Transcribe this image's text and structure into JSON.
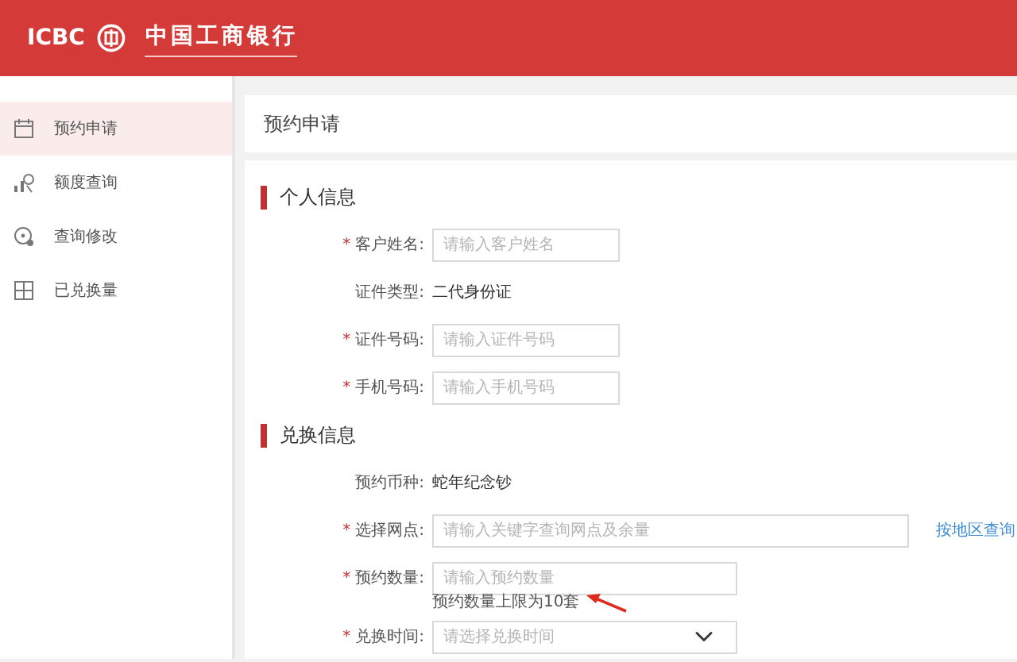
{
  "header": {
    "logo_text": "ICBC",
    "bank_name": "中国工商银行"
  },
  "sidebar": {
    "items": [
      {
        "label": "预约申请",
        "selected": true
      },
      {
        "label": "额度查询",
        "selected": false
      },
      {
        "label": "查询修改",
        "selected": false
      },
      {
        "label": "已兑换量",
        "selected": false
      }
    ]
  },
  "page_title": "预约申请",
  "sections": [
    {
      "title": "个人信息",
      "fields": [
        {
          "kind": "input",
          "required_mark": "*",
          "label": "客户姓名:",
          "placeholder": "请输入客户姓名"
        },
        {
          "kind": "text",
          "label": "证件类型:",
          "value": "二代身份证"
        },
        {
          "kind": "input",
          "required_mark": "*",
          "label": "证件号码:",
          "placeholder": "请输入证件号码"
        },
        {
          "kind": "input",
          "required_mark": "*",
          "label": "手机号码:",
          "placeholder": "请输入手机号码"
        }
      ]
    },
    {
      "title": "兑换信息",
      "fields": [
        {
          "kind": "text",
          "label": "预约币种:",
          "value": "蛇年纪念钞"
        },
        {
          "kind": "input",
          "required_mark": "*",
          "label": "选择网点:",
          "placeholder": "请输入关键字查询网点及余量",
          "link": "按地区查询"
        },
        {
          "kind": "input",
          "required_mark": "*",
          "label": "预约数量:",
          "placeholder": "请输入预约数量",
          "hint": "预约数量上限为10套"
        },
        {
          "kind": "select",
          "required_mark": "*",
          "label": "兑换时间:",
          "placeholder": "请选择兑换时间"
        }
      ]
    }
  ]
}
